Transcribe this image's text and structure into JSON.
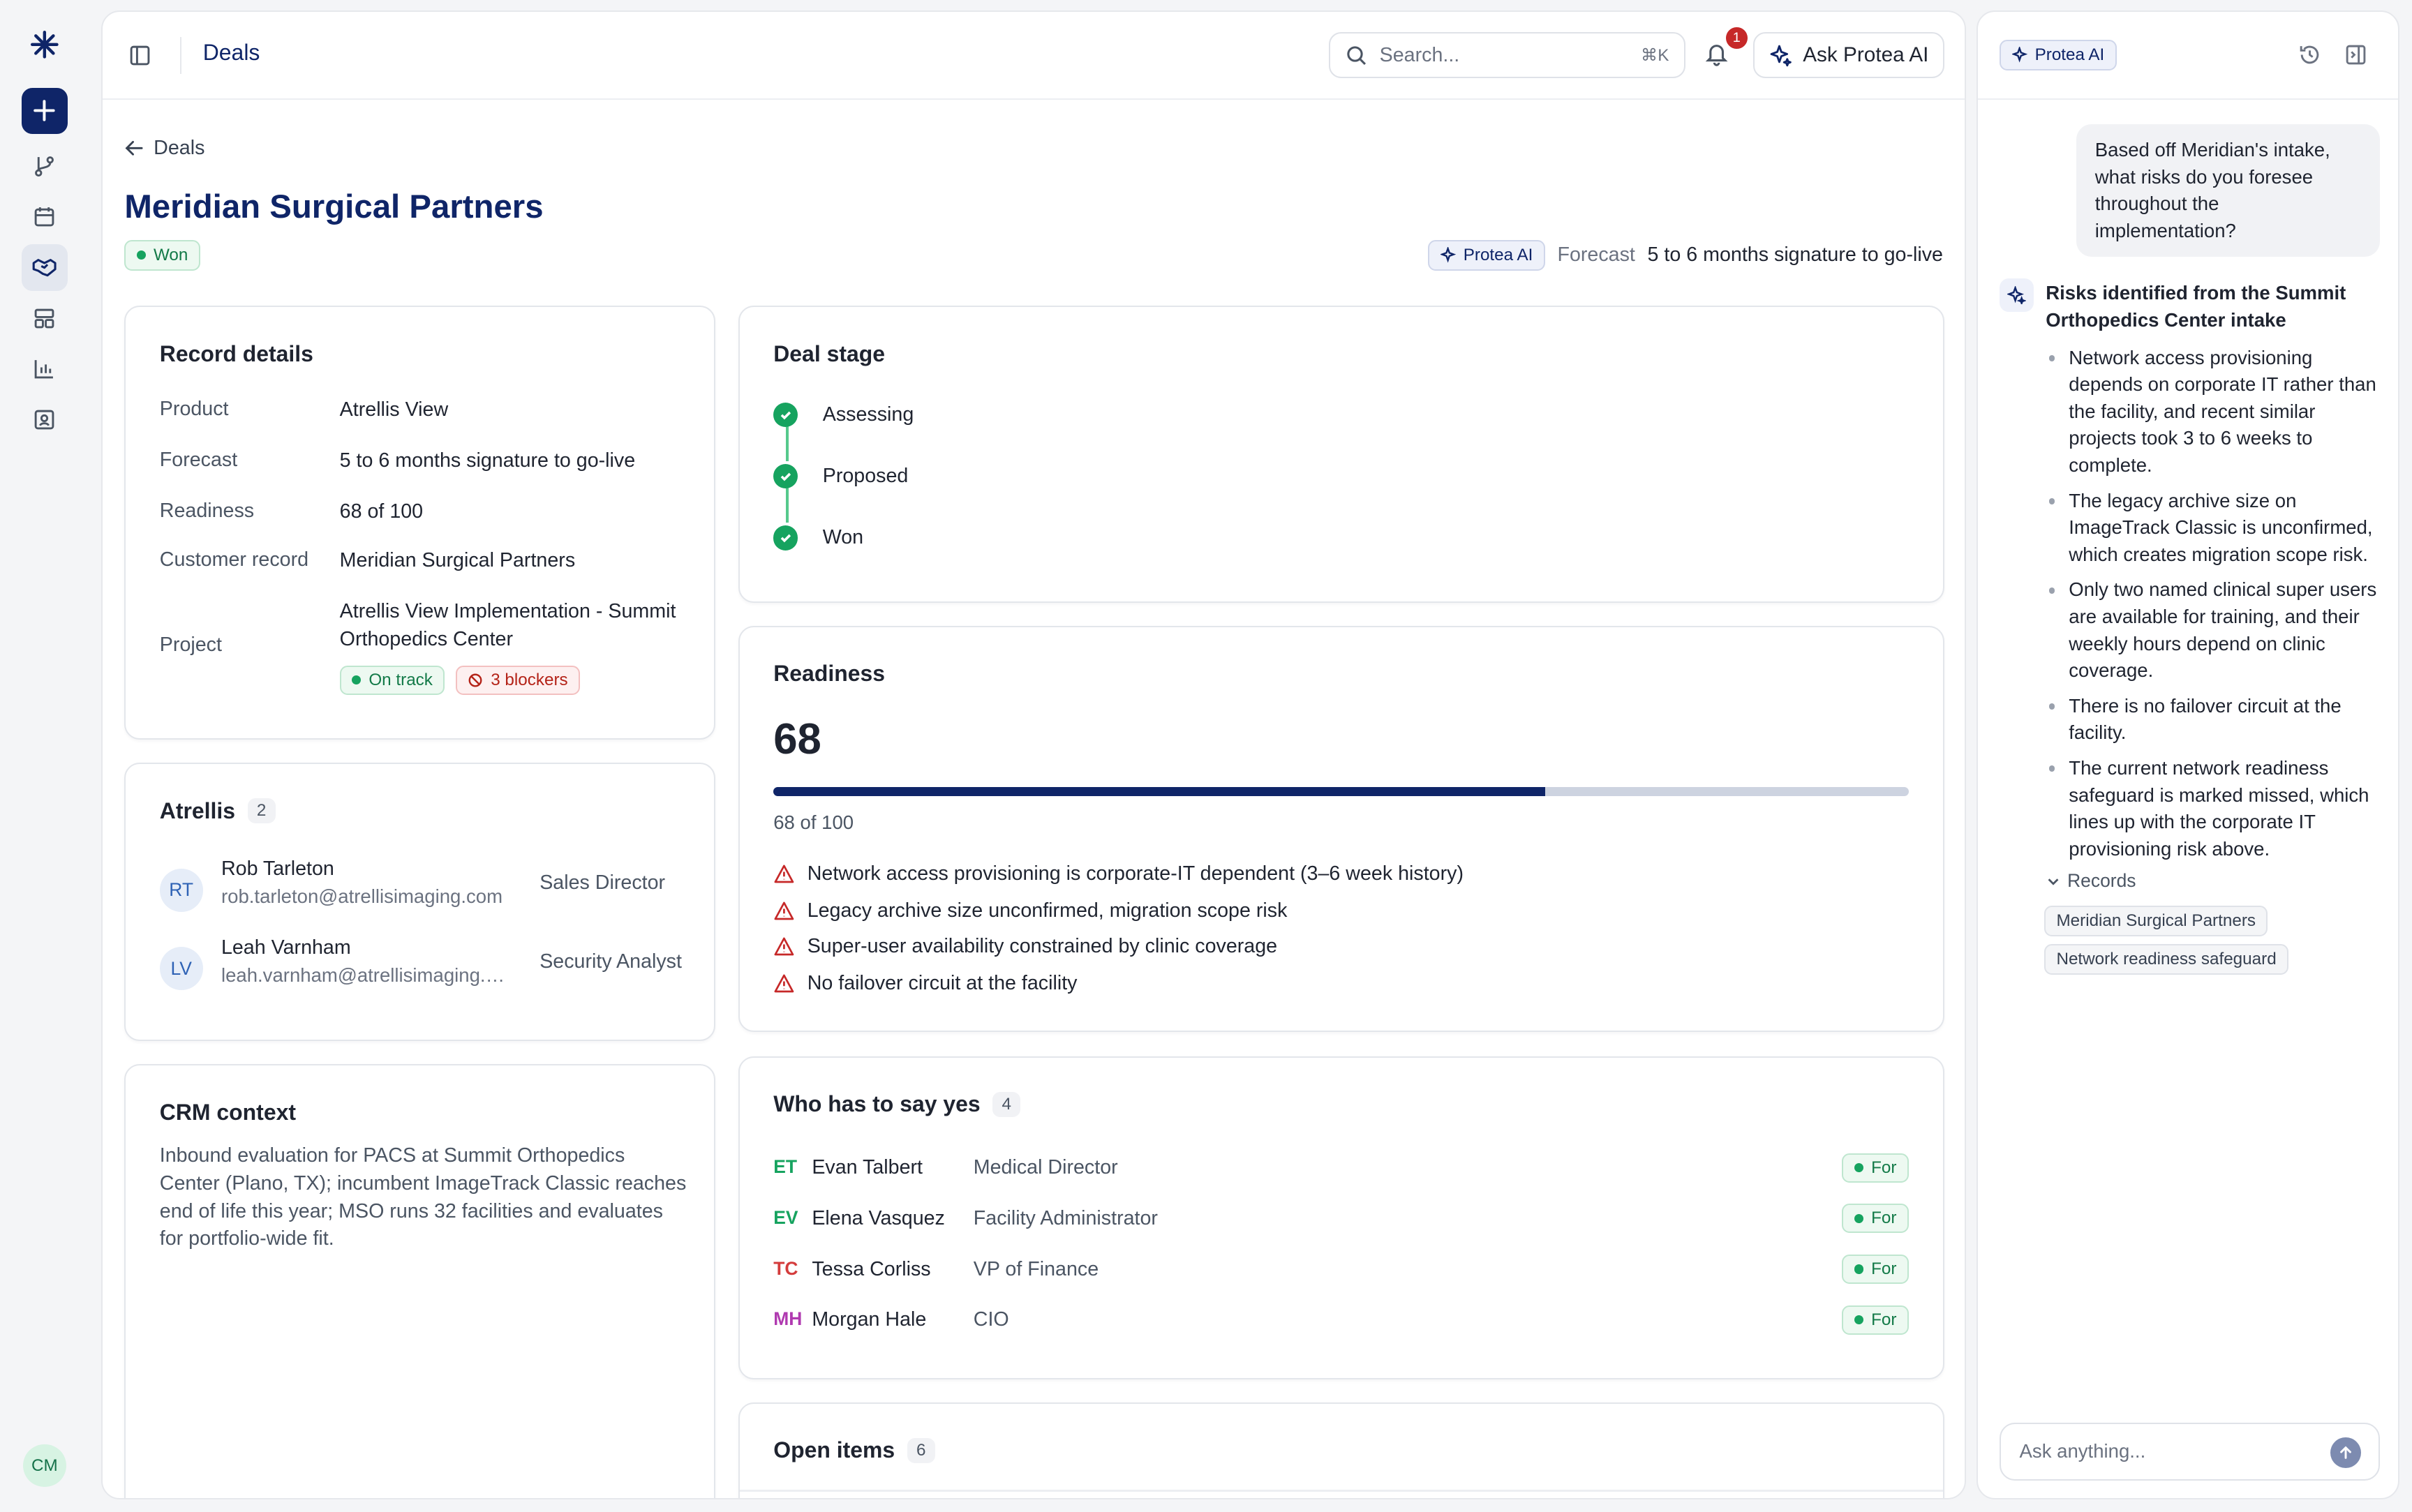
{
  "rail": {
    "logo_icon": "asterisk-logo-icon",
    "new_icon": "plus-icon",
    "nav_icons": [
      "branch-icon",
      "calendar-icon",
      "handshake-icon",
      "layout-icon",
      "bar-chart-icon",
      "contact-icon"
    ],
    "user_initials": "CM"
  },
  "topbar": {
    "breadcrumb": "Deals",
    "search_placeholder": "Search...",
    "search_shortcut": "⌘K",
    "notification_count": "1",
    "ask_button": "Ask Protea AI"
  },
  "header": {
    "back_label": "Deals",
    "title": "Meridian Surgical Partners",
    "status": "Won",
    "ai_badge": "Protea AI",
    "forecast_label": "Forecast",
    "forecast_value": "5 to 6 months signature to go-live"
  },
  "record_details": {
    "title": "Record details",
    "rows": [
      {
        "label": "Product",
        "value": "Atrellis View"
      },
      {
        "label": "Forecast",
        "value": "5 to 6 months signature to go-live"
      },
      {
        "label": "Readiness",
        "value": "68 of 100"
      },
      {
        "label": "Customer record",
        "value": "Meridian Surgical Partners"
      },
      {
        "label": "Project",
        "value": "Atrellis View Implementation - Summit Orthopedics Center"
      }
    ],
    "project_status": "On track",
    "project_blockers": "3 blockers"
  },
  "team": {
    "title": "Atrellis",
    "count": "2",
    "members": [
      {
        "initials": "RT",
        "name": "Rob Tarleton",
        "email": "rob.tarleton@atrellisimaging.com",
        "role": "Sales Director"
      },
      {
        "initials": "LV",
        "name": "Leah Varnham",
        "email": "leah.varnham@atrellisimaging.com",
        "role": "Security Analyst"
      }
    ]
  },
  "crm": {
    "title": "CRM context",
    "text": "Inbound evaluation for PACS at Summit Orthopedics Center (Plano, TX); incumbent ImageTrack Classic reaches end of life this year; MSO runs 32 facilities and evaluates for portfolio-wide fit."
  },
  "deal_stage": {
    "title": "Deal stage",
    "stages": [
      "Assessing",
      "Proposed",
      "Won"
    ]
  },
  "readiness": {
    "title": "Readiness",
    "score": "68",
    "fraction": 0.68,
    "of_label": "68 of 100",
    "risks": [
      "Network access provisioning is corporate-IT dependent (3–6 week history)",
      "Legacy archive size unconfirmed, migration scope risk",
      "Super-user availability constrained by clinic coverage",
      "No failover circuit at the facility"
    ]
  },
  "approvers": {
    "title": "Who has to say yes",
    "count": "4",
    "people": [
      {
        "initials": "ET",
        "name": "Evan Talbert",
        "role": "Medical Director",
        "stance": "For",
        "color": "#16a35f"
      },
      {
        "initials": "EV",
        "name": "Elena Vasquez",
        "role": "Facility Administrator",
        "stance": "For",
        "color": "#16a35f"
      },
      {
        "initials": "TC",
        "name": "Tessa Corliss",
        "role": "VP of Finance",
        "stance": "For",
        "color": "#d43c3c"
      },
      {
        "initials": "MH",
        "name": "Morgan Hale",
        "role": "CIO",
        "stance": "For",
        "color": "#b03ab0"
      }
    ]
  },
  "open_items": {
    "title": "Open items",
    "count": "6"
  },
  "ai_panel": {
    "badge": "Protea AI",
    "history_icon": "history-icon",
    "collapse_icon": "panel-collapse-icon",
    "user_message": "Based off Meridian's intake, what risks do you foresee throughout the implementation?",
    "answer_title": "Risks identified from the Summit Orthopedics Center intake",
    "bullets": [
      "Network access provisioning depends on corporate IT rather than the facility, and recent similar projects took 3 to 6 weeks to complete.",
      "The legacy archive size on ImageTrack Classic is unconfirmed, which creates migration scope risk.",
      "Only two named clinical super users are available for training, and their weekly hours depend on clinic coverage.",
      "There is no failover circuit at the facility.",
      "The current network readiness safeguard is marked missed, which lines up with the corporate IT provisioning risk above."
    ],
    "records_label": "Records",
    "records": [
      "Meridian Surgical Partners",
      "Network readiness safeguard"
    ],
    "input_placeholder": "Ask anything..."
  }
}
